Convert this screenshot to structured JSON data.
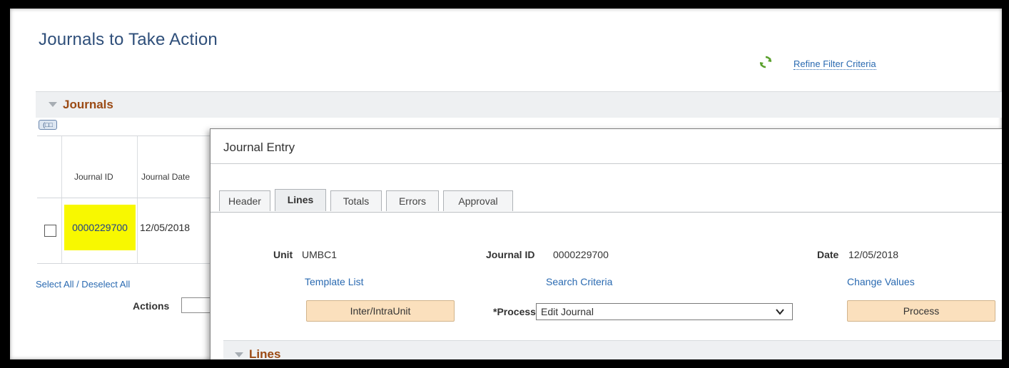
{
  "page": {
    "title": "Journals to Take Action",
    "refine_link": "Refine Filter Criteria"
  },
  "journals": {
    "section_label": "Journals",
    "grid_icon_text": "(□□",
    "columns": [
      "Journal ID",
      "Journal Date"
    ],
    "rows": [
      {
        "journal_id": "0000229700",
        "journal_date": "12/05/2018"
      }
    ],
    "select_all": "Select All / Deselect All",
    "actions_label": "Actions"
  },
  "modal": {
    "title": "Journal Entry",
    "tabs": [
      "Header",
      "Lines",
      "Totals",
      "Errors",
      "Approval"
    ],
    "active_tab": "Lines",
    "unit_label": "Unit",
    "unit_value": "UMBC1",
    "journal_id_label": "Journal ID",
    "journal_id_value": "0000229700",
    "date_label": "Date",
    "date_value": "12/05/2018",
    "template_list": "Template List",
    "search_criteria": "Search Criteria",
    "change_values": "Change Values",
    "inter_button": "Inter/IntraUnit",
    "process_label": "*Process",
    "process_value": "Edit Journal",
    "process_button": "Process",
    "lines_section": "Lines"
  },
  "colors": {
    "highlight": "#f8f800",
    "section_label": "#9b4a14",
    "link": "#2a6ab1",
    "button_bg": "#fbe0bd"
  },
  "icons": [
    "refresh-icon",
    "triangle-collapse-icon",
    "grid-view-icon",
    "chevron-down-icon"
  ]
}
